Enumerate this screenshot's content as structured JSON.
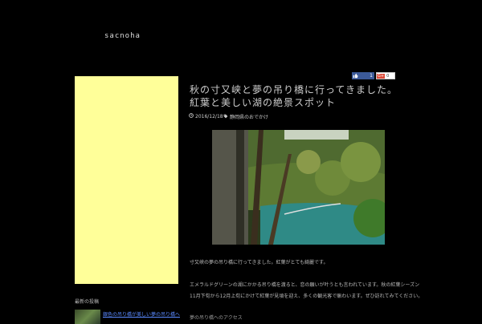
{
  "site": {
    "logo": "sacnoha"
  },
  "sidebar": {
    "heading": "最新の投稿",
    "recent_post_link": "銀色の吊り橋が美しい夢の吊り橋へ行ってきました。"
  },
  "social": {
    "fb_count": "1",
    "gplus_label": "G+",
    "gplus_count": "0"
  },
  "post": {
    "title": "秋の寸又峡と夢の吊り橋に行ってきました。紅葉と美しい湖の絶景スポット",
    "date": "2016/12/18",
    "tag": "静岡県のおでかけ",
    "paragraphs": [
      "寸又峡の夢の吊り橋に行ってきました。紅葉がとても綺麗です。",
      "エメラルドグリーンの湖にかかる吊り橋を渡ると、恋の願いが叶うとも言われています。秋の紅葉シーズン",
      "11月下旬から12月上旬にかけて紅葉が見頃を迎え、多くの観光客で賑わいます。ぜひ訪れてみてください。",
      "夢の吊り橋へのアクセス"
    ]
  },
  "colors": {
    "background": "#000000",
    "ad_placeholder": "#ffff99",
    "link": "#5a8aff"
  }
}
